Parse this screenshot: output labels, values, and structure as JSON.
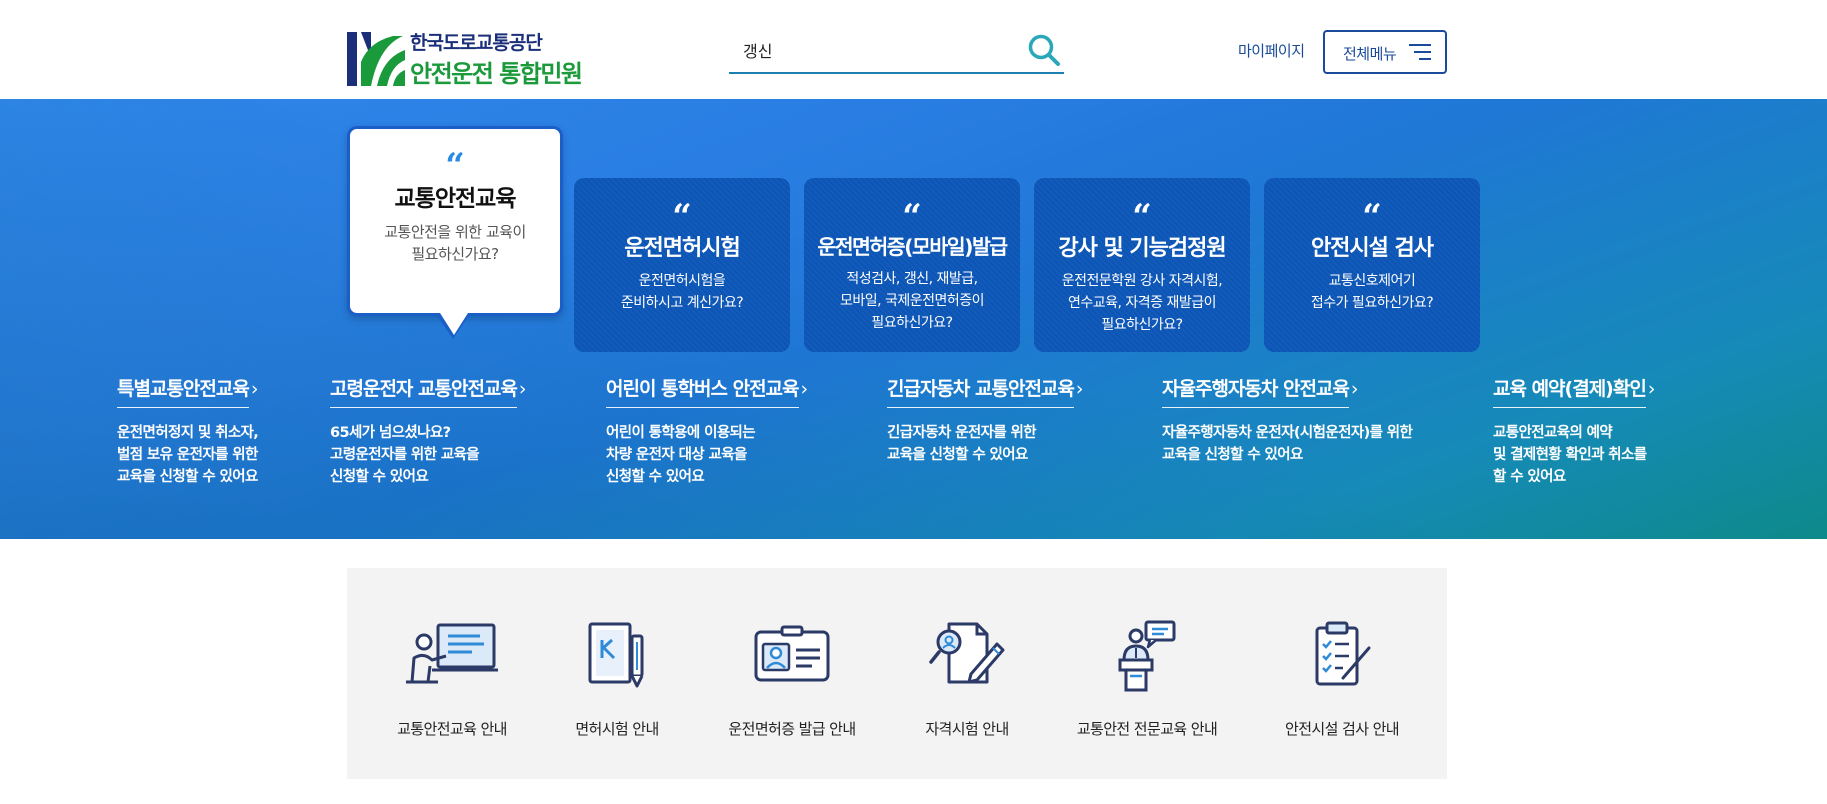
{
  "header": {
    "logo_line1": "한국도로교통공단",
    "logo_line2": "안전운전 통합민원",
    "search_value": "갱신",
    "mypage_label": "마이페이지",
    "allmenu_label": "전체메뉴"
  },
  "hero": {
    "cards": [
      {
        "title": "교통안전교육",
        "desc1": "교통안전을 위한 교육이",
        "desc2": "필요하신가요?",
        "desc3": ""
      },
      {
        "title": "운전면허시험",
        "desc1": "운전면허시험을",
        "desc2": "준비하시고 계신가요?",
        "desc3": ""
      },
      {
        "title": "운전면허증(모바일)발급",
        "desc1": "적성검사, 갱신, 재발급,",
        "desc2": "모바일, 국제운전면허증이",
        "desc3": "필요하신가요?"
      },
      {
        "title": "강사 및 기능검정원",
        "desc1": "운전전문학원 강사 자격시험,",
        "desc2": "연수교육, 자격증 재발급이",
        "desc3": "필요하신가요?"
      },
      {
        "title": "안전시설 검사",
        "desc1": "교통신호제어기",
        "desc2": "접수가 필요하신가요?",
        "desc3": ""
      }
    ],
    "quote_glyph": "“",
    "chevron": "›",
    "subs": [
      {
        "title": "특별교통안전교육",
        "l1": "운전면허정지 및 취소자,",
        "l2": "벌점 보유 운전자를 위한",
        "l3": "교육을 신청할 수 있어요"
      },
      {
        "title": "고령운전자 교통안전교육",
        "l1": "65세가 넘으셨나요?",
        "l2": "고령운전자를 위한 교육을",
        "l3": "신청할 수 있어요"
      },
      {
        "title": "어린이 통학버스 안전교육",
        "l1": "어린이 통학용에 이용되는",
        "l2": "차량 운전자 대상 교육을",
        "l3": "신청할 수 있어요"
      },
      {
        "title": "긴급자동차 교통안전교육",
        "l1": "긴급자동차 운전자를 위한",
        "l2": "교육을 신청할 수 있어요",
        "l3": ""
      },
      {
        "title": "자율주행자동차 안전교육",
        "l1": "자율주행자동차 운전자(시험운전자)를 위한",
        "l2": "교육을 신청할 수 있어요",
        "l3": ""
      },
      {
        "title": "교육 예약(결제)확인",
        "l1": "교통안전교육의 예약",
        "l2": "및 결제현황 확인과 취소를",
        "l3": "할 수 있어요"
      }
    ]
  },
  "guide": {
    "items": [
      {
        "label": "교통안전교육 안내",
        "icon": "teacher-board-icon"
      },
      {
        "label": "면허시험 안내",
        "icon": "license-book-pen-icon"
      },
      {
        "label": "운전면허증 발급 안내",
        "icon": "id-card-icon"
      },
      {
        "label": "자격시험 안내",
        "icon": "document-search-pen-icon"
      },
      {
        "label": "교통안전 전문교육 안내",
        "icon": "lecturer-podium-icon"
      },
      {
        "label": "안전시설 검사 안내",
        "icon": "clipboard-checklist-icon"
      }
    ]
  },
  "colors": {
    "brand_navy": "#1a2e7a",
    "brand_green": "#1a9a3a",
    "accent_blue": "#1a4a9a",
    "card_blue": "#0d57b8",
    "icon_navy": "#2b3a66",
    "icon_blue": "#2f8ad8"
  }
}
